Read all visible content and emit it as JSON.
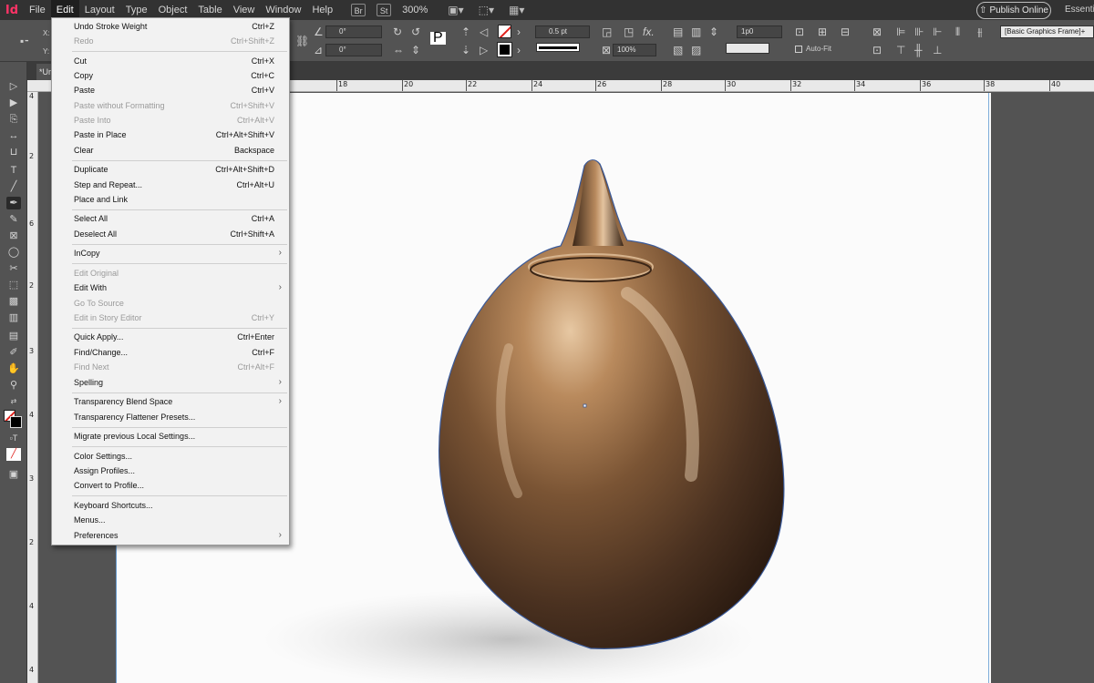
{
  "menubar": {
    "app_icon": "Id",
    "items": [
      "File",
      "Edit",
      "Layout",
      "Type",
      "Object",
      "Table",
      "View",
      "Window",
      "Help"
    ],
    "bridge": "Br",
    "stock": "St",
    "zoom": "300%",
    "publish": "Publish Online",
    "workspace": "Essenti"
  },
  "control": {
    "x_label": "X:",
    "y_label": "Y:",
    "angle1": "0°",
    "angle2": "0°",
    "stroke_weight": "0.5 pt",
    "opacity": "100%",
    "offset": "1p0",
    "autofit": "Auto-Fit",
    "object_style": "[Basic Graphics Frame]+"
  },
  "tabs": {
    "doc": "*Ur"
  },
  "ruler": {
    "h": [
      "18",
      "20",
      "22",
      "24",
      "26",
      "28",
      "30",
      "32",
      "34",
      "36",
      "38",
      "40"
    ],
    "v": [
      "4",
      "2",
      "6",
      "2",
      "3",
      "4",
      "3",
      "2",
      "4",
      "4"
    ]
  },
  "edit_menu": [
    {
      "label": "Undo Stroke Weight",
      "shortcut": "Ctrl+Z",
      "disabled": false
    },
    {
      "label": "Redo",
      "shortcut": "Ctrl+Shift+Z",
      "disabled": true
    },
    {
      "label": "Cut",
      "shortcut": "Ctrl+X",
      "disabled": false
    },
    {
      "label": "Copy",
      "shortcut": "Ctrl+C",
      "disabled": false
    },
    {
      "label": "Paste",
      "shortcut": "Ctrl+V",
      "disabled": false
    },
    {
      "label": "Paste without Formatting",
      "shortcut": "Ctrl+Shift+V",
      "disabled": true
    },
    {
      "label": "Paste Into",
      "shortcut": "Ctrl+Alt+V",
      "disabled": true
    },
    {
      "label": "Paste in Place",
      "shortcut": "Ctrl+Alt+Shift+V",
      "disabled": false
    },
    {
      "label": "Clear",
      "shortcut": "Backspace",
      "disabled": false
    },
    {
      "label": "Duplicate",
      "shortcut": "Ctrl+Alt+Shift+D",
      "disabled": false
    },
    {
      "label": "Step and Repeat...",
      "shortcut": "Ctrl+Alt+U",
      "disabled": false
    },
    {
      "label": "Place and Link",
      "shortcut": "",
      "disabled": false
    },
    {
      "label": "Select All",
      "shortcut": "Ctrl+A",
      "disabled": false
    },
    {
      "label": "Deselect All",
      "shortcut": "Ctrl+Shift+A",
      "disabled": false
    },
    {
      "label": "InCopy",
      "shortcut": "",
      "disabled": false
    },
    {
      "label": "Edit Original",
      "shortcut": "",
      "disabled": true
    },
    {
      "label": "Edit With",
      "shortcut": "",
      "disabled": false
    },
    {
      "label": "Go To Source",
      "shortcut": "",
      "disabled": true
    },
    {
      "label": "Edit in Story Editor",
      "shortcut": "Ctrl+Y",
      "disabled": true
    },
    {
      "label": "Quick Apply...",
      "shortcut": "Ctrl+Enter",
      "disabled": false
    },
    {
      "label": "Find/Change...",
      "shortcut": "Ctrl+F",
      "disabled": false
    },
    {
      "label": "Find Next",
      "shortcut": "Ctrl+Alt+F",
      "disabled": true
    },
    {
      "label": "Spelling",
      "shortcut": "",
      "disabled": false
    },
    {
      "label": "Transparency Blend Space",
      "shortcut": "",
      "disabled": false
    },
    {
      "label": "Transparency Flattener Presets...",
      "shortcut": "",
      "disabled": false
    },
    {
      "label": "Migrate previous Local Settings...",
      "shortcut": "",
      "disabled": false
    },
    {
      "label": "Color Settings...",
      "shortcut": "",
      "disabled": false
    },
    {
      "label": "Assign Profiles...",
      "shortcut": "",
      "disabled": false
    },
    {
      "label": "Convert to Profile...",
      "shortcut": "",
      "disabled": false
    },
    {
      "label": "Keyboard Shortcuts...",
      "shortcut": "",
      "disabled": false
    },
    {
      "label": "Menus...",
      "shortcut": "",
      "disabled": false
    },
    {
      "label": "Preferences",
      "shortcut": "",
      "disabled": false
    }
  ],
  "submenu_arrow": "›",
  "colors": {
    "accent_pink": "#ff3366",
    "selection_path": "#3a5a9a",
    "bronze": "#6b4a2c"
  }
}
